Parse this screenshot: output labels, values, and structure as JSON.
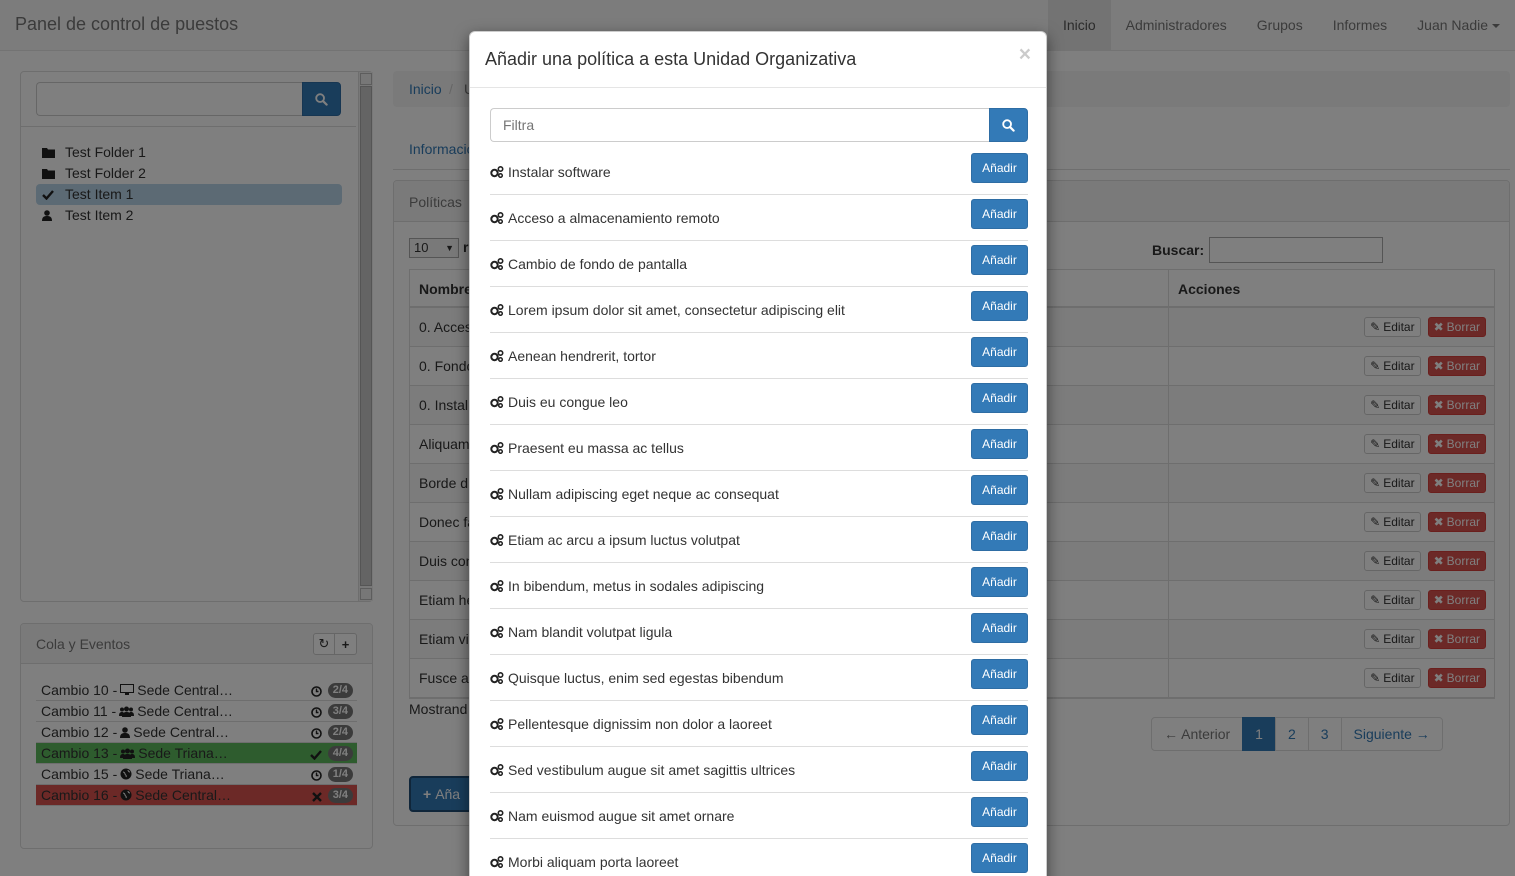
{
  "navbar": {
    "brand": "Panel de control de puestos",
    "items": [
      {
        "label": "Inicio",
        "active": true
      },
      {
        "label": "Administradores"
      },
      {
        "label": "Grupos"
      },
      {
        "label": "Informes"
      },
      {
        "label": "Juan Nadie"
      }
    ]
  },
  "tree": {
    "search_value": "",
    "items": [
      {
        "label": "Test Folder 1",
        "icon": "folder-icon"
      },
      {
        "label": "Test Folder 2",
        "icon": "folder-icon"
      },
      {
        "label": "Test Item 1",
        "icon": "check-icon",
        "selected": true
      },
      {
        "label": "Test Item 2",
        "icon": "user-icon"
      }
    ]
  },
  "queue": {
    "title": "Cola y Eventos",
    "items": [
      {
        "label": "Cambio 10 -",
        "target": "Sede Central…",
        "icon": "desktop-icon",
        "status": "clock-icon",
        "badge": "2/4"
      },
      {
        "label": "Cambio 11 -",
        "target": "Sede Central…",
        "icon": "users-icon",
        "status": "clock-icon",
        "badge": "3/4"
      },
      {
        "label": "Cambio 12 -",
        "target": "Sede Central…",
        "icon": "user-icon",
        "status": "clock-icon",
        "badge": "2/4"
      },
      {
        "label": "Cambio 13 -",
        "target": "Sede Triana…",
        "icon": "users-icon",
        "status": "check-icon",
        "badge": "4/4",
        "state": "ok"
      },
      {
        "label": "Cambio 15 -",
        "target": "Sede Triana…",
        "icon": "globe-icon",
        "status": "clock-icon",
        "badge": "1/4"
      },
      {
        "label": "Cambio 16 -",
        "target": "Sede Central…",
        "icon": "globe-icon",
        "status": "times-icon",
        "badge": "3/4",
        "state": "err"
      }
    ]
  },
  "content": {
    "breadcrumb": [
      "Inicio",
      "U"
    ],
    "tab_info": "Informació",
    "panel_title": "Políticas",
    "length_value": "10",
    "length_suffix": "r",
    "search_label": "Buscar:",
    "col_name": "Nombre",
    "col_actions": "Acciones",
    "rows": [
      "0. Acces",
      "0. Fondo",
      "0. Instal",
      "Aliquam",
      "Borde d",
      "Donec fa",
      "Duis con",
      "Etiam he",
      "Etiam viv",
      "Fusce a"
    ],
    "edit_label": "Editar",
    "delete_label": "Borrar",
    "showing": "Mostrand",
    "pager": {
      "prev": "← Anterior",
      "pages": [
        "1",
        "2",
        "3"
      ],
      "active": "1",
      "next": "Siguiente →"
    },
    "add_label": "Aña"
  },
  "modal": {
    "title": "Añadir una política a esta Unidad Organizativa",
    "close": "×",
    "filter_placeholder": "Filtra",
    "add_label": "Añadir",
    "policies": [
      "Instalar software",
      "Acceso a almacenamiento remoto",
      "Cambio de fondo de pantalla",
      "Lorem ipsum dolor sit amet, consectetur adipiscing elit",
      "Aenean hendrerit, tortor",
      "Duis eu congue leo",
      "Praesent eu massa ac tellus",
      "Nullam adipiscing eget neque ac consequat",
      "Etiam ac arcu a ipsum luctus volutpat",
      "In bibendum, metus in sodales adipiscing",
      "Nam blandit volutpat ligula",
      "Quisque luctus, enim sed egestas bibendum",
      "Pellentesque dignissim non dolor a laoreet",
      "Sed vestibulum augue sit amet sagittis ultrices",
      "Nam euismod augue sit amet ornare",
      "Morbi aliquam porta laoreet"
    ]
  },
  "colors": {
    "primary": "#337ab7",
    "danger": "#d9534f",
    "success": "#5cb85c"
  }
}
